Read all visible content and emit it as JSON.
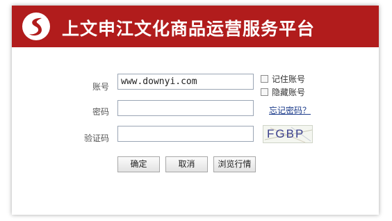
{
  "header": {
    "title": "上文申江文化商品运营服务平台",
    "brand_color": "#b11c1c",
    "logo_icon": "swoosh-logo-icon"
  },
  "form": {
    "account": {
      "label": "账号",
      "value": "www.downyi.com"
    },
    "password": {
      "label": "密码",
      "value": ""
    },
    "captcha": {
      "label": "验证码",
      "value": "",
      "image_text": "FGBP"
    },
    "remember": {
      "label": "记住账号",
      "checked": false
    },
    "hide_account": {
      "label": "隐藏账号",
      "checked": false
    },
    "forgot_link": "忘记密码？"
  },
  "buttons": {
    "confirm": "确定",
    "cancel": "取消",
    "browse": "浏览行情"
  }
}
